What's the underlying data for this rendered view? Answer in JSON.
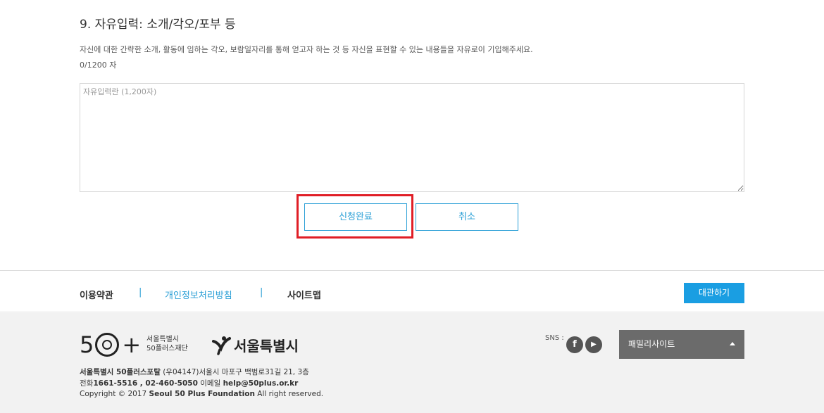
{
  "form": {
    "section_title": "9. 자유입력: 소개/각오/포부 등",
    "description": "자신에 대한 간략한 소개, 활동에 임하는 각오, 보람일자리를 통해 얻고자 하는 것 등 자신을 표현할 수 있는 내용들을 자유로이 기입해주세요.",
    "char_count": "0/1200 자",
    "textarea_placeholder": "자유입력란 (1,200자)",
    "submit_label": "신청완료",
    "cancel_label": "취소"
  },
  "footer": {
    "links": {
      "terms": "이용약관",
      "privacy": "개인정보처리방침",
      "sitemap": "사이트맵",
      "separator": "|"
    },
    "rental_button": "대관하기",
    "logo": {
      "big_text": "5",
      "plus_text": "+",
      "org_line1": "서울특별시",
      "org_line2": "50플러스재단",
      "seoul_text": "서울특별시"
    },
    "sns_label": "SNS :",
    "sns_facebook": "f",
    "sns_youtube": "▶",
    "family_site": "패밀리사이트",
    "address": {
      "org_prefix": "서울특별시 50플러스포탈",
      "addr_rest": " (우04147)서울시 마포구 백범로31길 21, 3층",
      "phone_prefix": "전화",
      "phone": "1661-5516 , 02-460-5050",
      "email_prefix": " 이메일 ",
      "email": "help@50plus.or.kr",
      "copyright_prefix": "Copyright © 2017 ",
      "copyright_org": "Seoul 50 Plus Foundation",
      "copyright_suffix": " All right reserved."
    }
  },
  "colors": {
    "accent": "#2a9fd6",
    "highlight": "#e01e26",
    "rental_button": "#1a9ee2",
    "family_bg": "#6b6b6b"
  }
}
